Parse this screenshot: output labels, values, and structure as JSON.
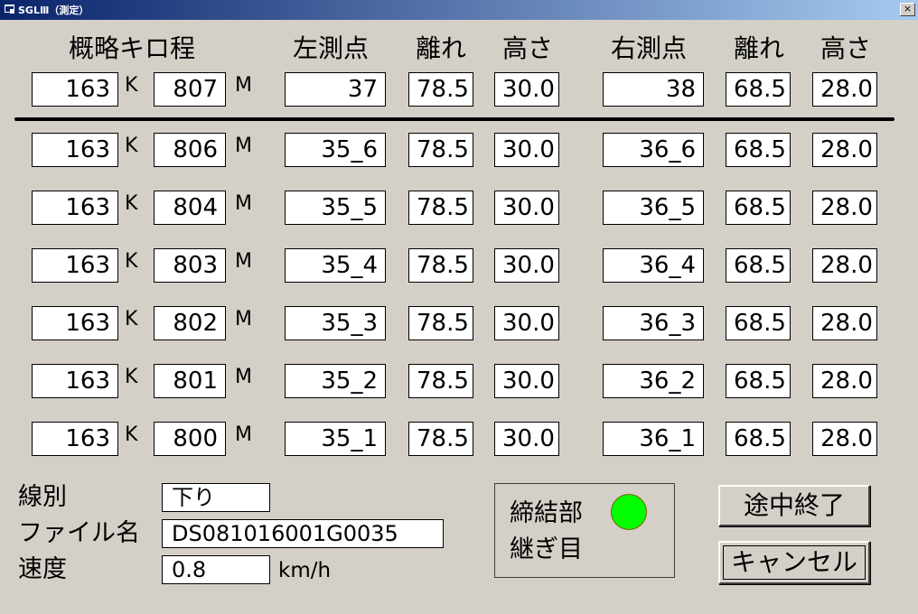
{
  "window": {
    "title": "SGLⅢ（測定）",
    "close_label": "×"
  },
  "headers": {
    "kilo": "概略キロ程",
    "left_point": "左測点",
    "left_distance": "離れ",
    "left_height": "高さ",
    "right_point": "右測点",
    "right_distance": "離れ",
    "right_height": "高さ"
  },
  "units": {
    "k": "K",
    "m": "M",
    "speed_unit": "km/h"
  },
  "current": {
    "km": "163",
    "m": "807",
    "left_point": "37",
    "left_distance": "78.5",
    "left_height": "30.0",
    "right_point": "38",
    "right_distance": "68.5",
    "right_height": "28.0"
  },
  "rows": [
    {
      "km": "163",
      "m": "806",
      "left_point": "35_6",
      "left_distance": "78.5",
      "left_height": "30.0",
      "right_point": "36_6",
      "right_distance": "68.5",
      "right_height": "28.0"
    },
    {
      "km": "163",
      "m": "804",
      "left_point": "35_5",
      "left_distance": "78.5",
      "left_height": "30.0",
      "right_point": "36_5",
      "right_distance": "68.5",
      "right_height": "28.0"
    },
    {
      "km": "163",
      "m": "803",
      "left_point": "35_4",
      "left_distance": "78.5",
      "left_height": "30.0",
      "right_point": "36_4",
      "right_distance": "68.5",
      "right_height": "28.0"
    },
    {
      "km": "163",
      "m": "802",
      "left_point": "35_3",
      "left_distance": "78.5",
      "left_height": "30.0",
      "right_point": "36_3",
      "right_distance": "68.5",
      "right_height": "28.0"
    },
    {
      "km": "163",
      "m": "801",
      "left_point": "35_2",
      "left_distance": "78.5",
      "left_height": "30.0",
      "right_point": "36_2",
      "right_distance": "68.5",
      "right_height": "28.0"
    },
    {
      "km": "163",
      "m": "800",
      "left_point": "35_1",
      "left_distance": "78.5",
      "left_height": "30.0",
      "right_point": "36_1",
      "right_distance": "68.5",
      "right_height": "28.0"
    }
  ],
  "info": {
    "line_label": "線別",
    "line_value": "下り",
    "file_label": "ファイル名",
    "file_value": "DS081016001G0035",
    "speed_label": "速度",
    "speed_value": "0.8"
  },
  "status": {
    "line1": "締結部",
    "line2": "継ぎ目",
    "indicator_color": "#00ff00"
  },
  "buttons": {
    "interrupt": "途中終了",
    "cancel": "キャンセル"
  }
}
